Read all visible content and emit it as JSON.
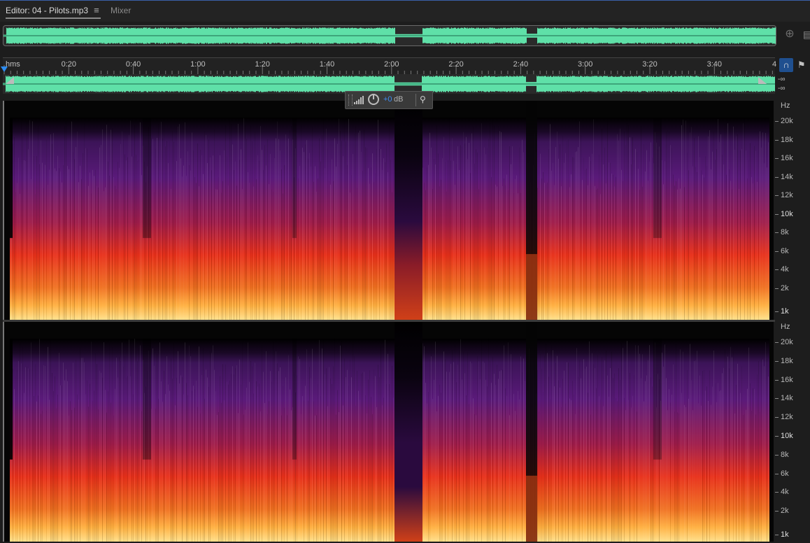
{
  "tabs": {
    "editor_label": "Editor: 04 - Pilots.mp3",
    "editor_menu_glyph": "≡",
    "mixer_label": "Mixer"
  },
  "overview": {
    "waveform_color": "#5fe0a8",
    "zoom_icon": "zoom-icon",
    "panel_menu_icon": "panel-menu-icon"
  },
  "ruler": {
    "unit_label": "hms",
    "ticks": [
      "0:20",
      "0:40",
      "1:00",
      "1:20",
      "1:40",
      "2:00",
      "2:20",
      "2:40",
      "3:00",
      "3:20",
      "3:40",
      "4"
    ],
    "snap_icon": "magnet-icon",
    "marker_icon": "marker-icon"
  },
  "track": {
    "level_top": "-∞",
    "level_bottom": "-∞",
    "waveform_color": "#5fe0a8"
  },
  "hud": {
    "volume_value": "+0",
    "volume_unit": "dB",
    "pin_glyph": "📌"
  },
  "spectral": {
    "unit": "Hz",
    "labels": [
      "20k",
      "18k",
      "16k",
      "14k",
      "12k",
      "10k",
      "8k",
      "6k",
      "4k",
      "2k",
      "1k"
    ],
    "colors": {
      "background": "#050505",
      "low": "#ffe08a",
      "mid": "#e8301a",
      "high": "#5a1a7a"
    }
  }
}
